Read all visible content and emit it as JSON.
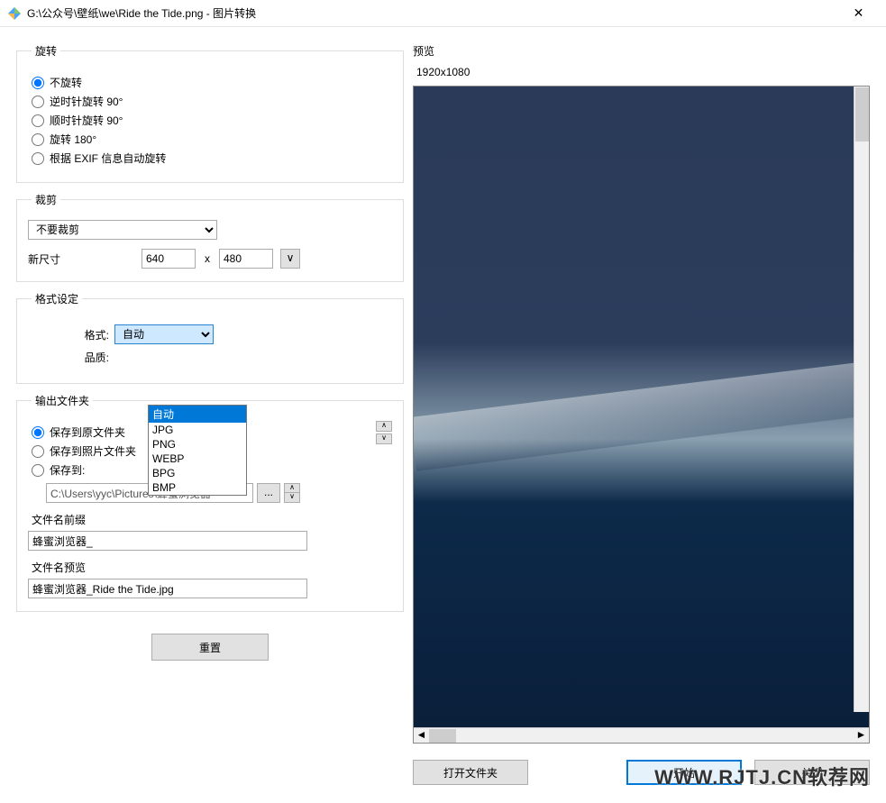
{
  "window": {
    "title": "G:\\公众号\\壁纸\\we\\Ride the Tide.png - 图片转换",
    "close": "✕"
  },
  "rotate": {
    "legend": "旋转",
    "options": [
      "不旋转",
      "逆时针旋转 90°",
      "顺时针旋转 90°",
      "旋转 180°",
      "根据 EXIF 信息自动旋转"
    ],
    "selected": 0
  },
  "crop": {
    "legend": "裁剪",
    "mode": "不要裁剪",
    "newsize_label": "新尺寸",
    "width": "640",
    "height": "480",
    "x": "x",
    "v": "∨"
  },
  "format": {
    "legend": "格式设定",
    "label_format": "格式:",
    "label_quality": "品质:",
    "selected": "自动",
    "options": [
      "自动",
      "JPG",
      "PNG",
      "WEBP",
      "BPG",
      "BMP"
    ]
  },
  "output": {
    "legend": "输出文件夹",
    "radios": [
      "保存到原文件夹",
      "保存到照片文件夹",
      "保存到:"
    ],
    "selected": 0,
    "path": "C:\\Users\\yyc\\Pictures\\蜂蜜浏览器",
    "browse": "...",
    "prefix_label": "文件名前缀",
    "prefix_value": "蜂蜜浏览器_",
    "preview_label": "文件名预览",
    "preview_value": "蜂蜜浏览器_Ride the Tide.jpg"
  },
  "reset_label": "重置",
  "preview": {
    "label": "预览",
    "dims": "1920x1080"
  },
  "buttons": {
    "open_folder": "打开文件夹",
    "start": "开始",
    "close": "关闭"
  },
  "watermark": "WWW.RJTJ.CN软荐网"
}
